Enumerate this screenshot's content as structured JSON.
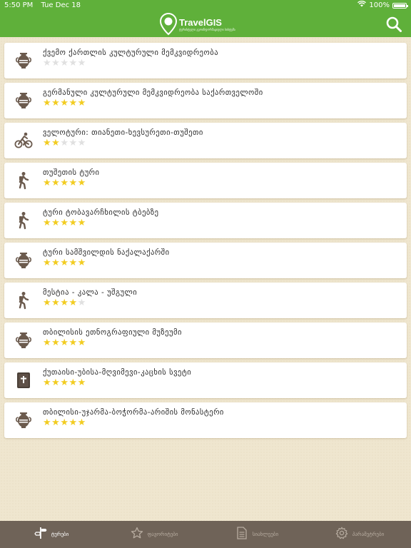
{
  "status": {
    "time": "5:50 PM",
    "date": "Tue Dec 18",
    "battery": "100%"
  },
  "header": {
    "app_name": "TravelGIS",
    "tagline": "ტურისტული გეოინფორმაციული სისტემა"
  },
  "colors": {
    "accent": "#5fb03a",
    "star_on": "#f2cc21",
    "star_off": "#e0e0e0",
    "tabbar": "#6f6358"
  },
  "tours": [
    {
      "title": "ქვემო ქართლის კულტურული მემკვიდრეობა",
      "icon": "amphora-icon",
      "rating": 0
    },
    {
      "title": "გერმანული კულტურული მემკვიდრეობა საქართველოში",
      "icon": "amphora-icon",
      "rating": 5
    },
    {
      "title": "ველოტური: თიანეთი-ხევსურეთი-თუშეთი",
      "icon": "bicycle-icon",
      "rating": 2
    },
    {
      "title": "თუშეთის ტური",
      "icon": "hiker-icon",
      "rating": 5
    },
    {
      "title": "ტური ტობავარჩხილის ტბებზე",
      "icon": "hiker-icon",
      "rating": 5
    },
    {
      "title": "ტური სამშვილდის ნაქალაქარში",
      "icon": "amphora-icon",
      "rating": 5
    },
    {
      "title": "მესტია - კალა - უშგული",
      "icon": "hiker-icon",
      "rating": 4
    },
    {
      "title": "თბილისის ეთნოგრაფიული მუზეუმი",
      "icon": "amphora-icon",
      "rating": 5
    },
    {
      "title": "ქუთაისი-უბისა-მღვიმევი-კაცხის სვეტი",
      "icon": "bible-icon",
      "rating": 5
    },
    {
      "title": "თბილისი-უჯარმა-ბოჭორმა-არიშის მონასტერი",
      "icon": "amphora-icon",
      "rating": 5
    }
  ],
  "tabs": [
    {
      "label": "ტურები",
      "icon": "signpost-icon",
      "active": true
    },
    {
      "label": "ფავორიტები",
      "icon": "star-icon",
      "active": false
    },
    {
      "label": "სიახლეები",
      "icon": "document-icon",
      "active": false
    },
    {
      "label": "პარამეტრები",
      "icon": "gear-icon",
      "active": false
    }
  ]
}
